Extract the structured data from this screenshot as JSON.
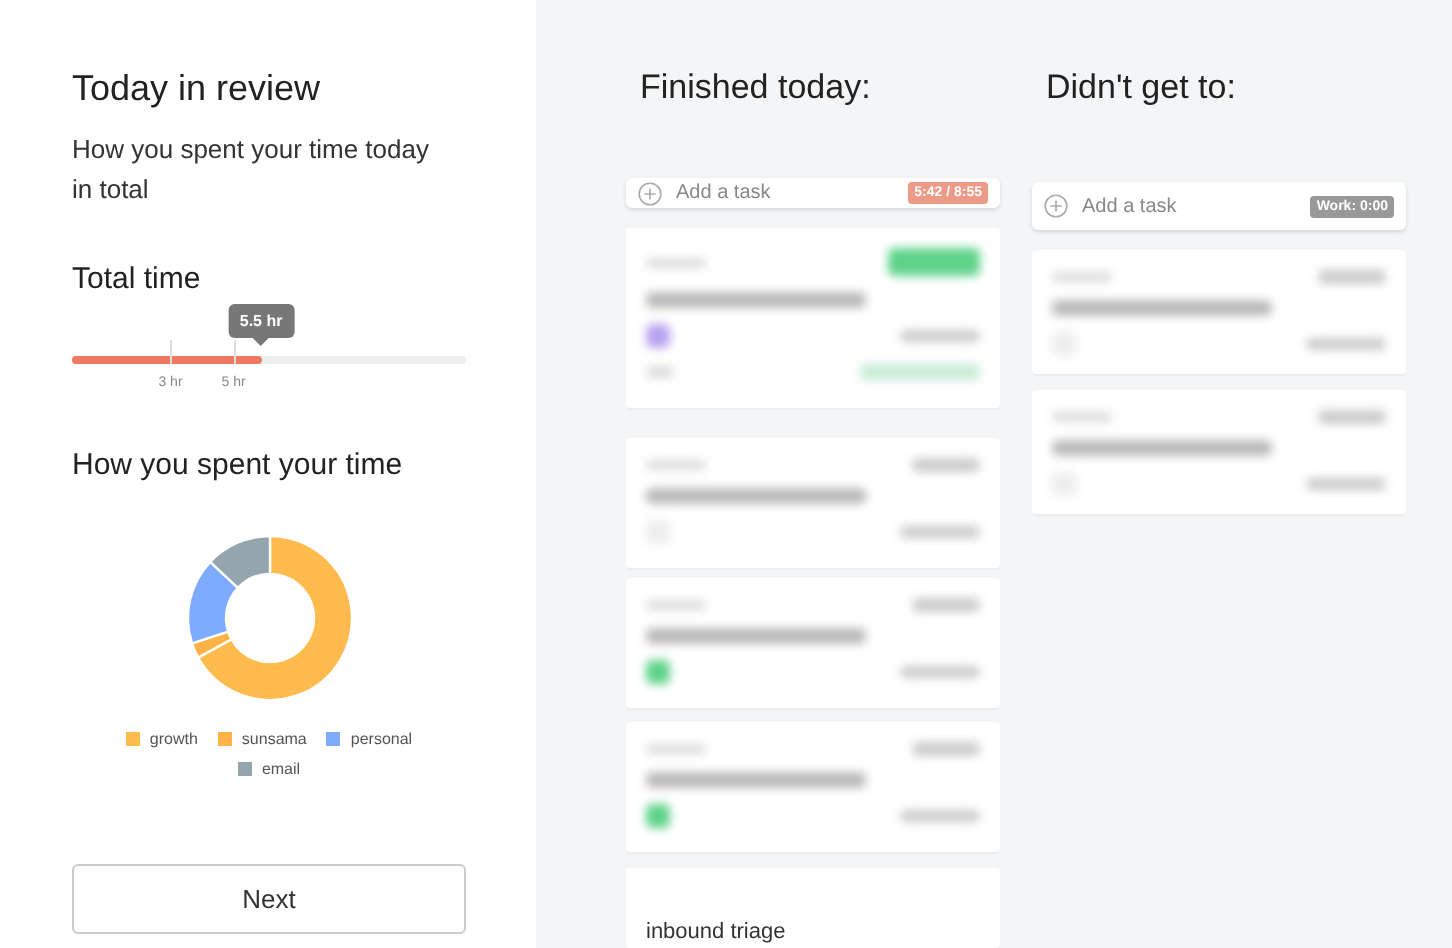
{
  "review": {
    "title": "Today in review",
    "subtitle": "How you spent your time today in total",
    "total_time": {
      "heading": "Total time",
      "tooltip": "5.5 hr",
      "level": 0.48,
      "ticks": [
        "3 hr",
        "5 hr"
      ]
    },
    "breakdown": {
      "heading": "How you spent your time",
      "legend": [
        {
          "label": "growth",
          "color": "#ffbb4d"
        },
        {
          "label": "sunsama",
          "color": "#ffb347"
        },
        {
          "label": "personal",
          "color": "#7eaaff"
        },
        {
          "label": "email",
          "color": "#95a5ad"
        }
      ]
    },
    "next_button": "Next"
  },
  "columns": [
    {
      "title": "Finished today:",
      "add_placeholder": "Add a task",
      "badge": "5:42 / 8:55",
      "over_budget": true,
      "last_task": "inbound triage"
    },
    {
      "title": "Didn't get to:",
      "add_placeholder": "Add a task",
      "badge": "Work: 0:00",
      "over_budget": false
    }
  ]
}
